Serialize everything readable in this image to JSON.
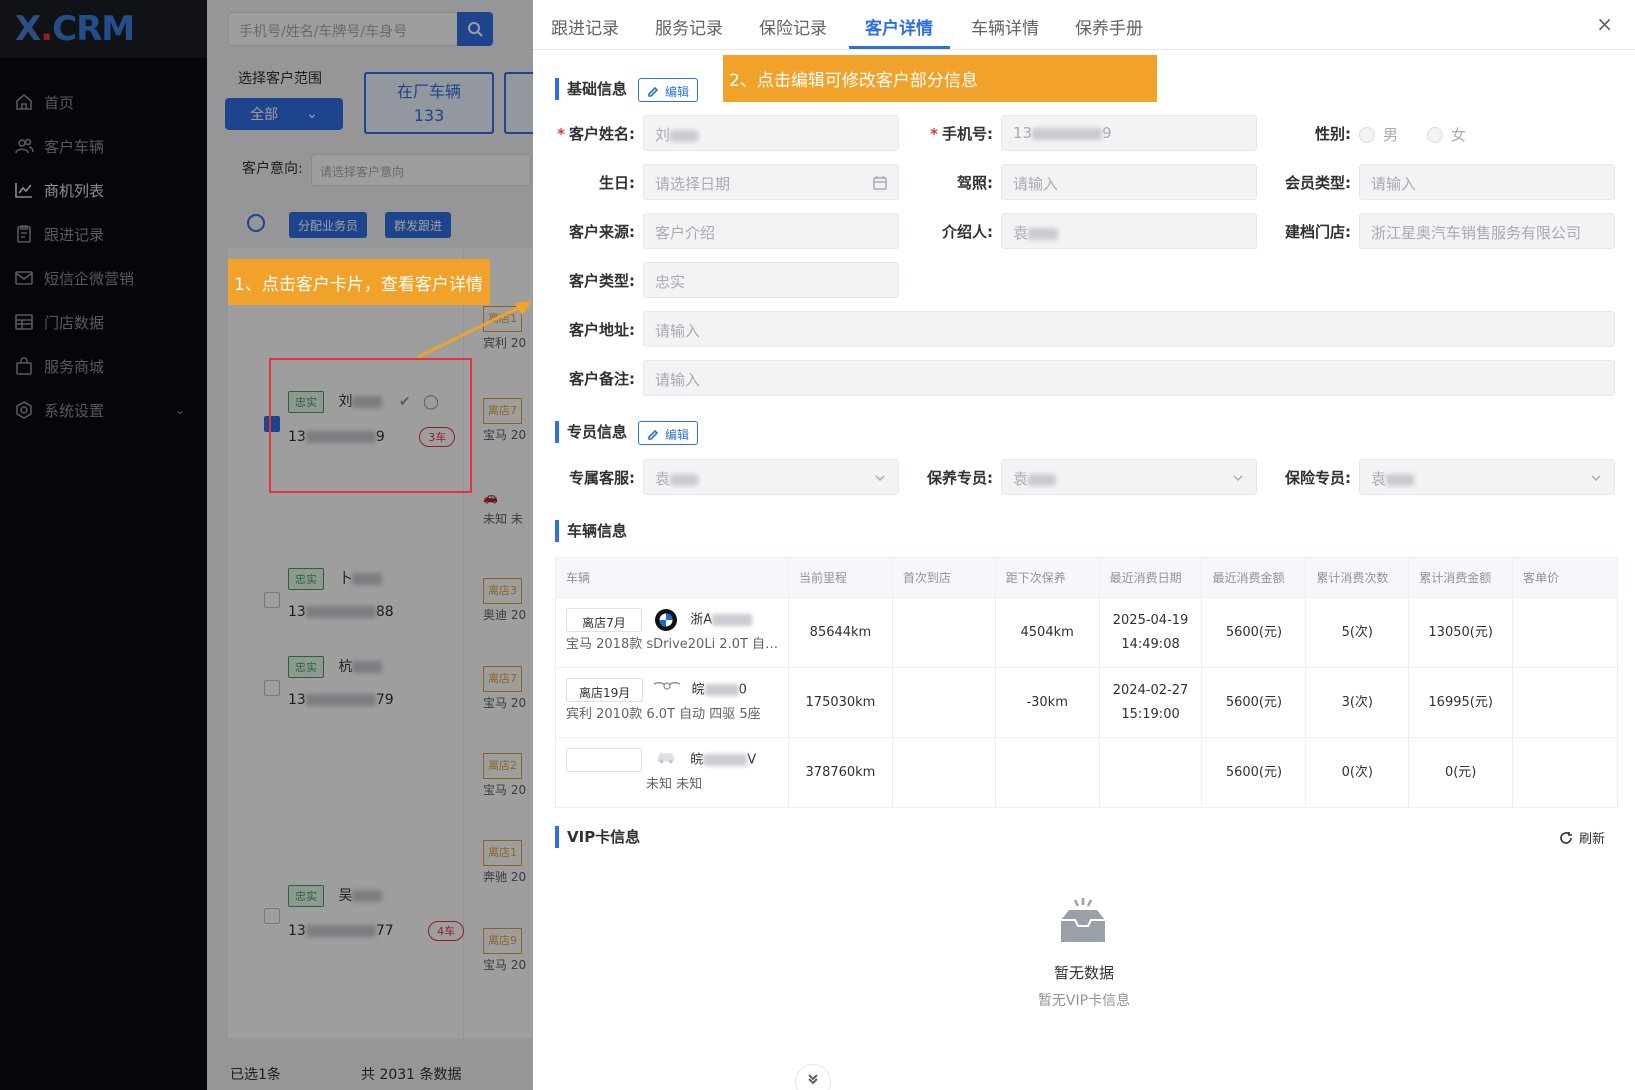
{
  "sidebar": {
    "logo": {
      "x": "X",
      "dot": ".",
      "crm": "CRM"
    },
    "items": [
      {
        "label": "首页",
        "icon": "home-icon"
      },
      {
        "label": "客户车辆",
        "icon": "users-icon"
      },
      {
        "label": "商机列表",
        "icon": "chart-line-icon"
      },
      {
        "label": "跟进记录",
        "icon": "clipboard-icon"
      },
      {
        "label": "短信企微营销",
        "icon": "mail-icon"
      },
      {
        "label": "门店数据",
        "icon": "table-icon"
      },
      {
        "label": "服务商城",
        "icon": "bag-icon"
      },
      {
        "label": "系统设置",
        "icon": "settings-icon"
      }
    ]
  },
  "middle": {
    "search_placeholder": "手机号/姓名/车牌号/车身号",
    "scope_label": "选择客户范围",
    "scope_value": "全部",
    "stat_card": {
      "label": "在厂车辆",
      "value": "133"
    },
    "intent_label": "客户意向:",
    "intent_placeholder": "请选择客户意向",
    "assign_btn": "分配业务员",
    "group_btn": "群发跟进",
    "cards": [
      {
        "tag": "忠实",
        "name": "刘",
        "phone_a": "13",
        "phone_b": "9",
        "cars": "3车",
        "checked": true
      },
      {
        "tag": "忠实",
        "name": "卜",
        "phone_a": "13",
        "phone_b": "88",
        "cars": "",
        "checked": false
      },
      {
        "tag": "忠实",
        "name": "杭",
        "phone_a": "13",
        "phone_b": "79",
        "cars": "",
        "checked": false
      },
      {
        "tag": "忠实",
        "name": "吴",
        "phone_a": "13",
        "phone_b": "77",
        "cars": "4车",
        "checked": false
      }
    ],
    "side_snippets": [
      {
        "shop": "离店1",
        "text": "宾利 20"
      },
      {
        "shop": "离店7",
        "text": "宝马 20"
      },
      {
        "shop": "",
        "text": "未知 未"
      },
      {
        "shop": "离店3",
        "text": "奥迪 20"
      },
      {
        "shop": "离店7",
        "text": "宝马 20"
      },
      {
        "shop": "离店2",
        "text": "宝马 20"
      },
      {
        "shop": "离店1",
        "text": "奔驰 20"
      },
      {
        "shop": "离店9",
        "text": "宝马 20"
      }
    ],
    "selected_text": "已选1条",
    "total_text": "共 2031 条数据",
    "callout1": "1、点击客户卡片，查看客户详情"
  },
  "drawer": {
    "tabs": [
      "跟进记录",
      "服务记录",
      "保险记录",
      "客户详情",
      "车辆详情",
      "保养手册"
    ],
    "active_tab": "客户详情",
    "close": "×",
    "basic": {
      "title": "基础信息",
      "edit": "编辑",
      "callout2": "2、点击编辑可修改客户部分信息",
      "name_label": "客户姓名:",
      "name_value": "刘",
      "phone_label": "手机号:",
      "phone_a": "13",
      "phone_b": "9",
      "gender_label": "性别:",
      "gender_male": "男",
      "gender_female": "女",
      "birthday_label": "生日:",
      "birthday_placeholder": "请选择日期",
      "license_label": "驾照:",
      "license_placeholder": "请输入",
      "member_label": "会员类型:",
      "member_placeholder": "请输入",
      "source_label": "客户来源:",
      "source_value": "客户介绍",
      "referrer_label": "介绍人:",
      "referrer_value": "袁",
      "store_label": "建档门店:",
      "store_value": "浙江星奥汽车销售服务有限公司",
      "type_label": "客户类型:",
      "type_value": "忠实",
      "address_label": "客户地址:",
      "address_placeholder": "请输入",
      "remark_label": "客户备注:",
      "remark_placeholder": "请输入"
    },
    "staff": {
      "title": "专员信息",
      "edit": "编辑",
      "cs_label": "专属客服:",
      "cs_value": "袁",
      "maint_label": "保养专员:",
      "maint_value": "袁",
      "ins_label": "保险专员:",
      "ins_value": "袁"
    },
    "vehicles": {
      "title": "车辆信息",
      "headers": [
        "车辆",
        "当前里程",
        "首次到店",
        "距下次保养",
        "最近消费日期",
        "最近消费金额",
        "累计消费次数",
        "累计消费金额",
        "客单价"
      ],
      "rows": [
        {
          "shop": "离店7月",
          "brand": "bmw-logo",
          "plate_a": "浙A",
          "plate_b": "",
          "desc": "宝马 2018款 sDrive20Li 2.0T 自动...",
          "mileage": "85644km",
          "first": "",
          "next": "4504km",
          "date_a": "2025-04-19",
          "date_b": "14:49:08",
          "amount": "5600(元)",
          "count": "5(次)",
          "total": "13050(元)",
          "avg": ""
        },
        {
          "shop": "离店19月",
          "brand": "bentley-logo",
          "plate_a": "皖",
          "plate_b": "0",
          "desc": "宾利 2010款 6.0T 自动 四驱 5座",
          "mileage": "175030km",
          "first": "",
          "next": "-30km",
          "date_a": "2024-02-27",
          "date_b": "15:19:00",
          "amount": "5600(元)",
          "count": "3(次)",
          "total": "16995(元)",
          "avg": ""
        },
        {
          "shop": "",
          "brand": "car-icon",
          "plate_a": "皖",
          "plate_b": "V",
          "desc": "未知 未知",
          "mileage": "378760km",
          "first": "",
          "next": "",
          "date_a": "",
          "date_b": "",
          "amount": "5600(元)",
          "count": "0(次)",
          "total": "0(元)",
          "avg": ""
        }
      ]
    },
    "vip": {
      "title": "VIP卡信息",
      "refresh": "刷新",
      "empty_title": "暂无数据",
      "empty_sub": "暂无VIP卡信息"
    }
  },
  "colors": {
    "primary": "#2f6fe4",
    "callout": "#f0a22b",
    "danger": "#e4343b",
    "success": "#3aa757"
  }
}
